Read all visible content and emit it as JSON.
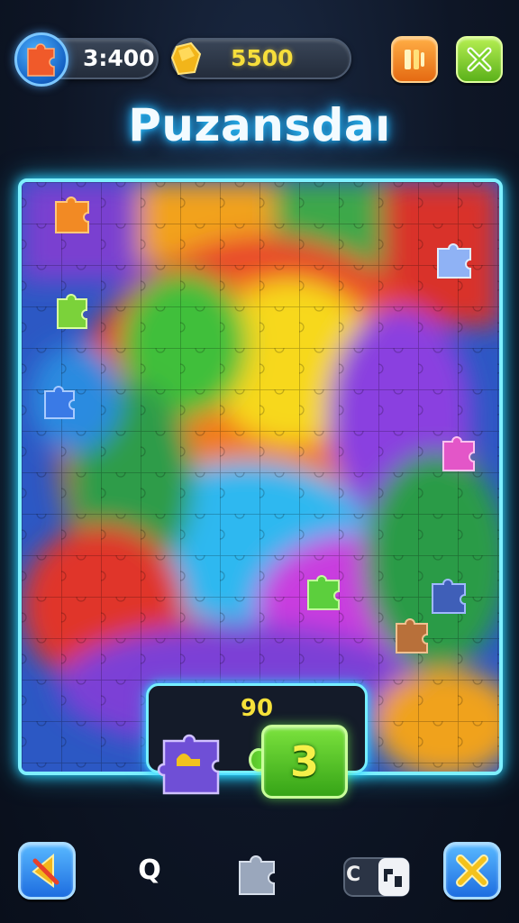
{
  "hud": {
    "coins": "3:400",
    "gems": "5500",
    "coin_icon": "puzzle-piece-icon",
    "gem_icon": "gold-gem-icon",
    "sound_icon": "speaker-icon",
    "close_icon": "close-x-icon"
  },
  "title": "Puzansdaı",
  "tray": {
    "score": "90",
    "remaining": "3"
  },
  "toolbar": {
    "search_label": "Q",
    "preview_label": "C",
    "icons": [
      "back-arrow-icon",
      "search-icon",
      "puzzle-piece-icon",
      "preview-icon",
      "shuffle-x-icon"
    ]
  },
  "colors": {
    "neon_border": "#7ff0ff",
    "coin_accent": "#2b8fff",
    "gem_accent": "#f6de3b",
    "counter_green": "#4fc826"
  }
}
